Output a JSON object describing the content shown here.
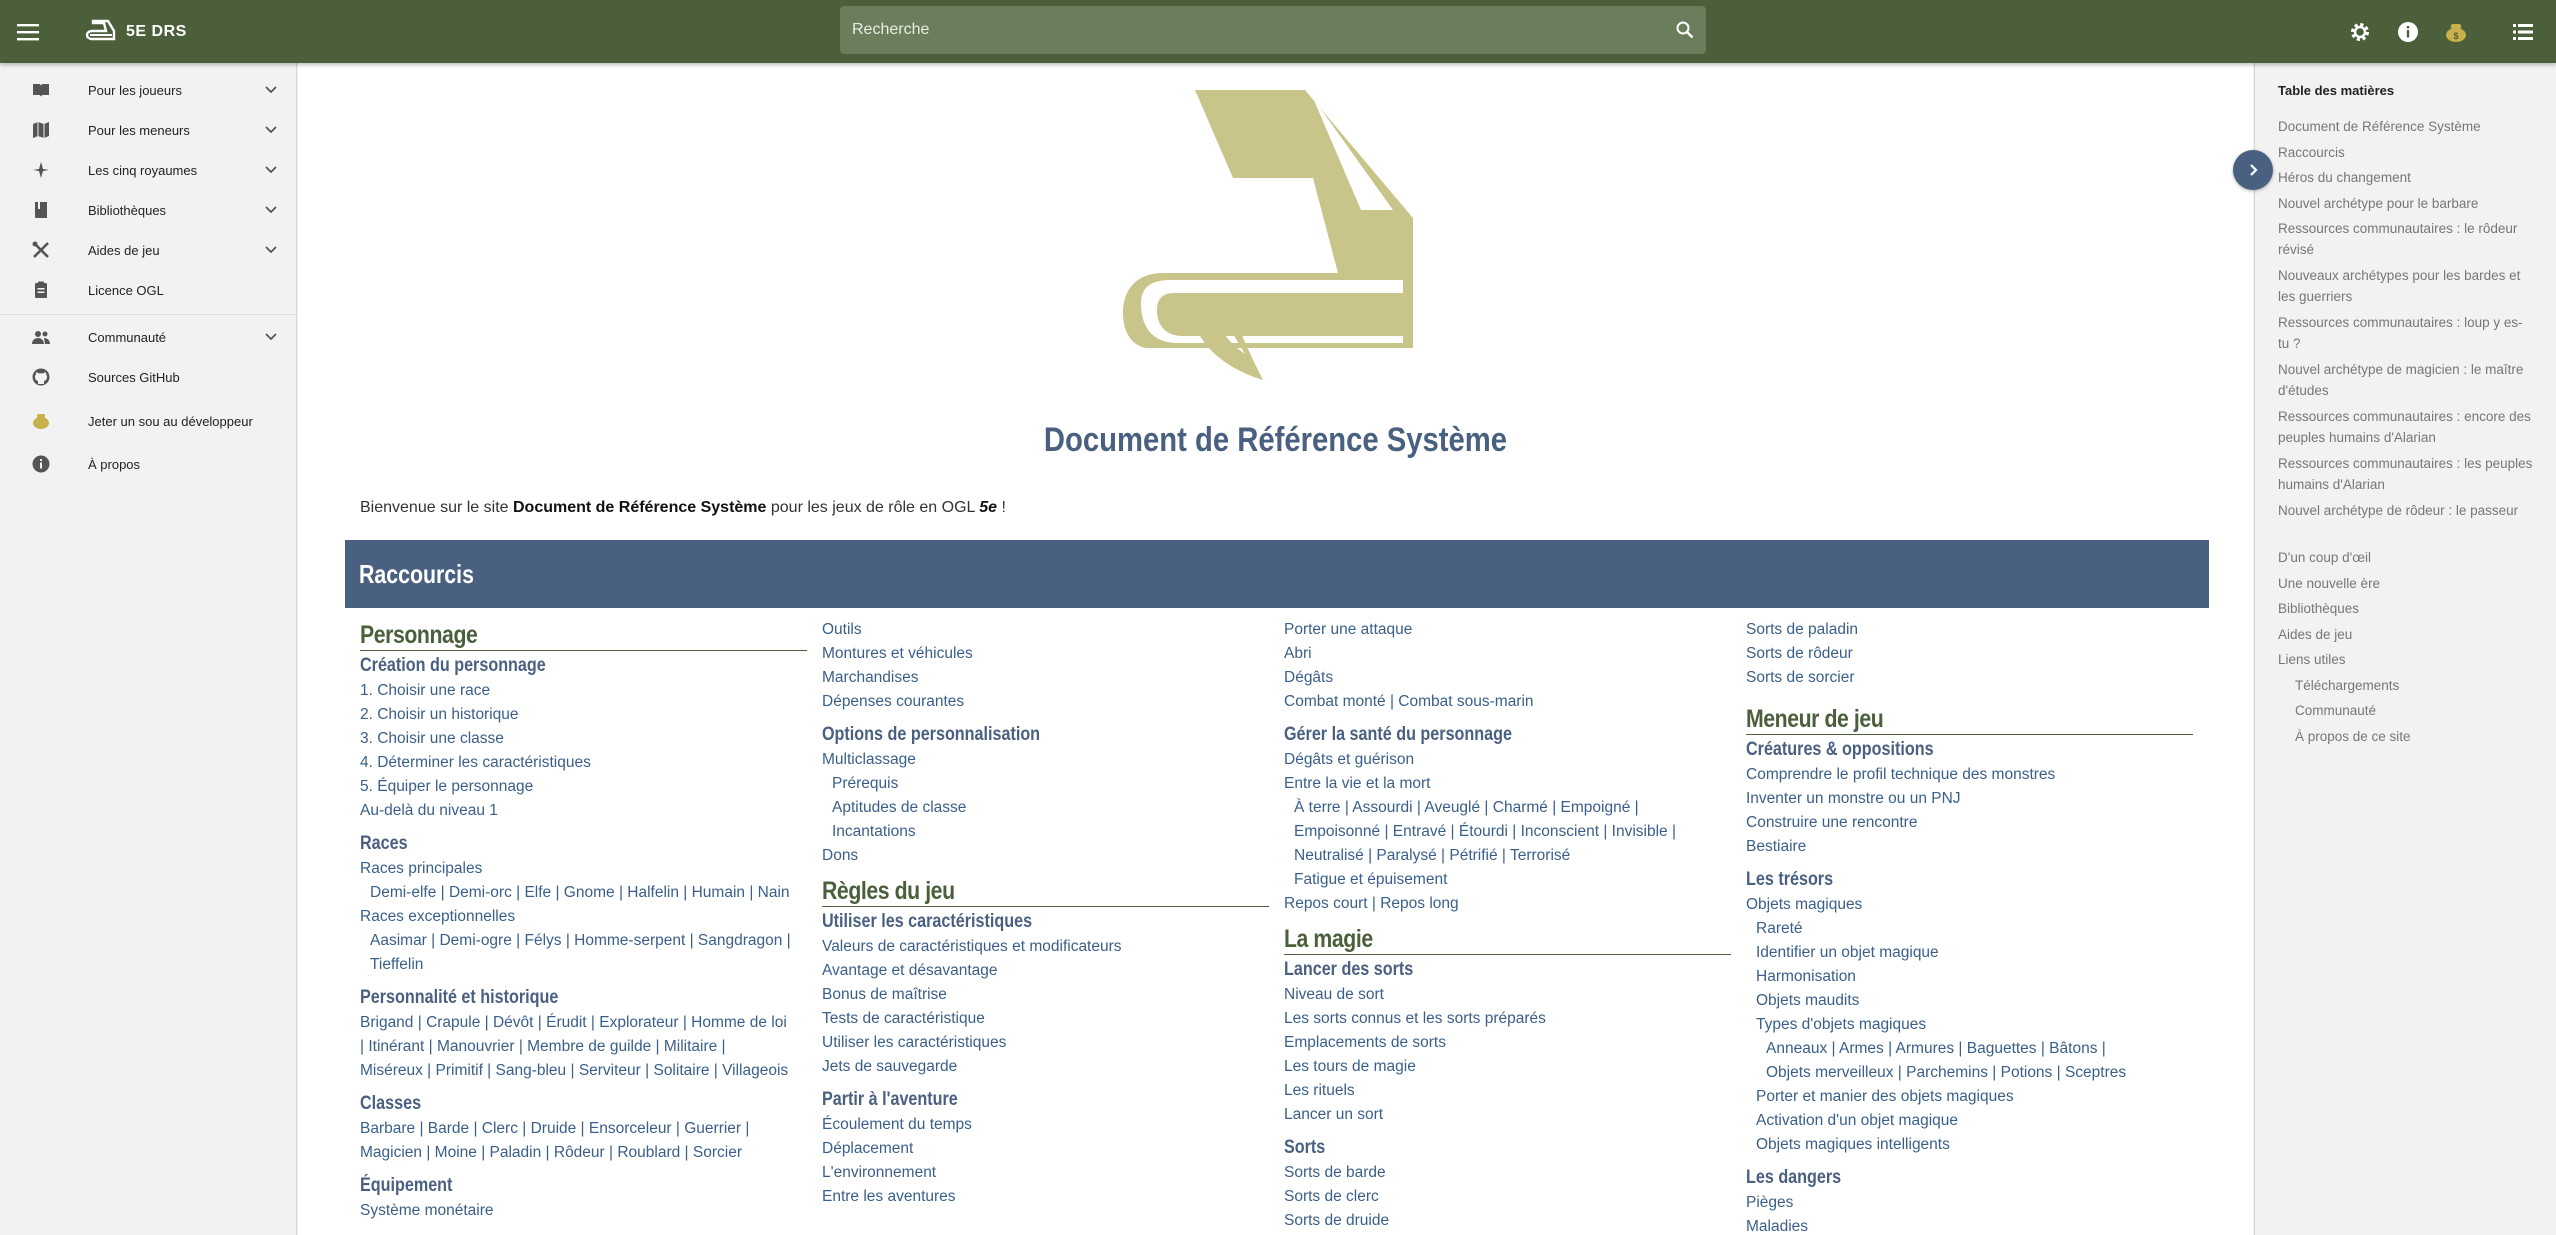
{
  "header": {
    "brand": "5E DRS",
    "search_placeholder": "Recherche"
  },
  "sidebar": {
    "items": [
      {
        "label": "Pour les joueurs",
        "icon": "book-open-icon",
        "expandable": true
      },
      {
        "label": "Pour les meneurs",
        "icon": "map-icon",
        "expandable": true
      },
      {
        "label": "Les cinq royaumes",
        "icon": "compass-rose-icon",
        "expandable": true
      },
      {
        "label": "Bibliothèques",
        "icon": "book-icon",
        "expandable": true
      },
      {
        "label": "Aides de jeu",
        "icon": "tools-icon",
        "expandable": true
      },
      {
        "label": "Licence OGL",
        "icon": "clipboard-icon",
        "expandable": false
      },
      {
        "label": "Communauté",
        "icon": "people-icon",
        "expandable": true
      },
      {
        "label": "Sources GitHub",
        "icon": "github-icon",
        "expandable": false
      },
      {
        "label": "Jeter un sou au développeur",
        "icon": "coin-purse-icon",
        "expandable": false
      },
      {
        "label": "À propos",
        "icon": "info-icon",
        "expandable": false
      }
    ]
  },
  "main": {
    "title": "Document de Référence Système",
    "welcome": {
      "pre": "Bienvenue sur le site ",
      "bold": "Document de Référence Système",
      "mid": " pour les jeux de rôle en OGL ",
      "em": "5e",
      "post": " !"
    },
    "raccourcis": "Raccourcis",
    "col1": {
      "h_personnage": "Personnage",
      "h_creation": "Création du personnage",
      "steps": [
        "1. Choisir une race",
        "2. Choisir un historique",
        "3. Choisir une classe",
        "4. Déterminer les caractéristiques",
        "5. Équiper le personnage"
      ],
      "au_dela": "Au-delà du niveau 1",
      "h_races": "Races",
      "races_principales": "Races principales",
      "races_principales_list": "Demi-elfe | Demi-orc | Elfe | Gnome | Halfelin | Humain | Nain",
      "races_exceptionnelles": "Races exceptionnelles",
      "races_exc_list1": "Aasimar | Demi-ogre | Félys | Homme-serpent | Sangdragon |",
      "races_exc_list2": "Tieffelin",
      "h_perso_hist": "Personnalité et historique",
      "hist1": "Brigand | Crapule | Dévôt | Érudit | Explorateur | Homme de loi",
      "hist2": "| Itinérant | Manouvrier | Membre de guilde | Militaire |",
      "hist3": "Miséreux | Primitif | Sang-bleu | Serviteur | Solitaire | Villageois",
      "h_classes": "Classes",
      "classes1": "Barbare | Barde | Clerc | Druide | Ensorceleur | Guerrier |",
      "classes2": "Magicien | Moine | Paladin | Rôdeur | Roublard | Sorcier",
      "h_equipement": "Équipement",
      "systeme_monetaire": "Système monétaire"
    },
    "col2": {
      "links_top": [
        "Outils",
        "Montures et véhicules",
        "Marchandises",
        "Dépenses courantes"
      ],
      "h_options": "Options de personnalisation",
      "multiclassage": "Multiclassage",
      "multi_sub": [
        "Prérequis",
        "Aptitudes de classe",
        "Incantations"
      ],
      "dons": "Dons",
      "h_regles": "Règles du jeu",
      "h_utiliser": "Utiliser les caractéristiques",
      "carac_links": [
        "Valeurs de caractéristiques et modificateurs",
        "Avantage et désavantage",
        "Bonus de maîtrise",
        "Tests de caractéristique",
        "Utiliser les caractéristiques",
        "Jets de sauvegarde"
      ],
      "h_aventure": "Partir à l'aventure",
      "aventure_links": [
        "Écoulement du temps",
        "Déplacement",
        "L'environnement",
        "Entre les aventures"
      ]
    },
    "col3": {
      "links_top": [
        "Porter une attaque",
        "Abri",
        "Dégâts",
        "Combat monté | Combat sous-marin"
      ],
      "h_sante": "Gérer la santé du personnage",
      "sante_links": [
        "Dégâts et guérison",
        "Entre la vie et la mort"
      ],
      "etats1": "À terre | Assourdi | Aveuglé | Charmé | Empoigné |",
      "etats2": "Empoisonné | Entravé | Étourdi | Inconscient | Invisible |",
      "etats3": "Neutralisé | Paralysé | Pétrifié | Terrorisé",
      "fatigue": "Fatigue et épuisement",
      "repos": "Repos court | Repos long",
      "h_magie": "La magie",
      "h_lancer": "Lancer des sorts",
      "lancer_links": [
        "Niveau de sort",
        "Les sorts connus et les sorts préparés",
        "Emplacements de sorts",
        "Les tours de magie",
        "Les rituels",
        "Lancer un sort"
      ],
      "h_sorts": "Sorts",
      "sorts_links": [
        "Sorts de barde",
        "Sorts de clerc",
        "Sorts de druide"
      ]
    },
    "col4": {
      "links_top": [
        "Sorts de paladin",
        "Sorts de rôdeur",
        "Sorts de sorcier"
      ],
      "h_meneur": "Meneur de jeu",
      "h_creatures": "Créatures & oppositions",
      "creatures_links": [
        "Comprendre le profil technique des monstres",
        "Inventer un monstre ou un PNJ",
        "Construire une rencontre",
        "Bestiaire"
      ],
      "h_tresors": "Les trésors",
      "objets_magiques": "Objets magiques",
      "objets_sub": [
        "Rareté",
        "Identifier un objet magique",
        "Harmonisation",
        "Objets maudits",
        "Types d'objets magiques"
      ],
      "types1": "Anneaux | Armes | Armures | Baguettes | Bâtons |",
      "types2": "Objets merveilleux | Parchemins | Potions | Sceptres",
      "objets_sub2": [
        "Porter et manier des objets magiques",
        "Activation d'un objet magique",
        "Objets magiques intelligents"
      ],
      "h_dangers": "Les dangers",
      "dangers_links": [
        "Pièges",
        "Maladies"
      ]
    }
  },
  "toc": {
    "title": "Table des matières",
    "items": [
      "Document de Référence Système",
      "Raccourcis",
      "Héros du changement",
      "Nouvel archétype pour le barbare",
      "Ressources communautaires : le rôdeur révisé",
      "Nouveaux archétypes pour les bardes et les guerriers",
      "Ressources communautaires : loup y es-tu ?",
      "Nouvel archétype de magicien : le maître d'études",
      "Ressources communautaires : encore des peuples humains d'Alarian",
      "Ressources communautaires : les peuples humains d'Alarian",
      "Nouvel archétype de rôdeur : le passeur",
      "D'un coup d'œil",
      "Une nouvelle ère",
      "Bibliothèques",
      "Aides de jeu",
      "Liens utiles"
    ],
    "sub_items": [
      "Téléchargements",
      "Communauté",
      "À propos de ce site"
    ]
  },
  "colors": {
    "header": "#4a5f3a",
    "accent_blue": "#4a6081",
    "heading_green": "#4a5f3a",
    "logo": "#c8c48a",
    "link": "#3a6089"
  }
}
